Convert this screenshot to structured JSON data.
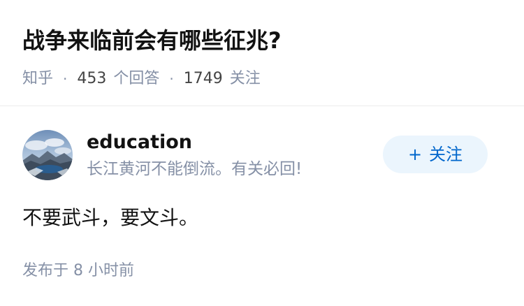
{
  "question": {
    "title": "战争来临前会有哪些征兆?",
    "source": "知乎",
    "answer_count": "453",
    "answer_label": "个回答",
    "follower_count": "1749",
    "follower_label": "关注",
    "separator": "·"
  },
  "author": {
    "name": "education",
    "bio": "长江黄河不能倒流。有关必回!",
    "avatar_icon": "landscape-avatar-icon"
  },
  "follow_button": {
    "icon": "+",
    "label": "关注",
    "bg_color": "#ebf5fd",
    "text_color": "#0066cc"
  },
  "answer": {
    "content": "不要武斗，要文斗。"
  },
  "publish": {
    "prefix": "发布于",
    "time_value": "8",
    "time_unit": "小时前"
  }
}
